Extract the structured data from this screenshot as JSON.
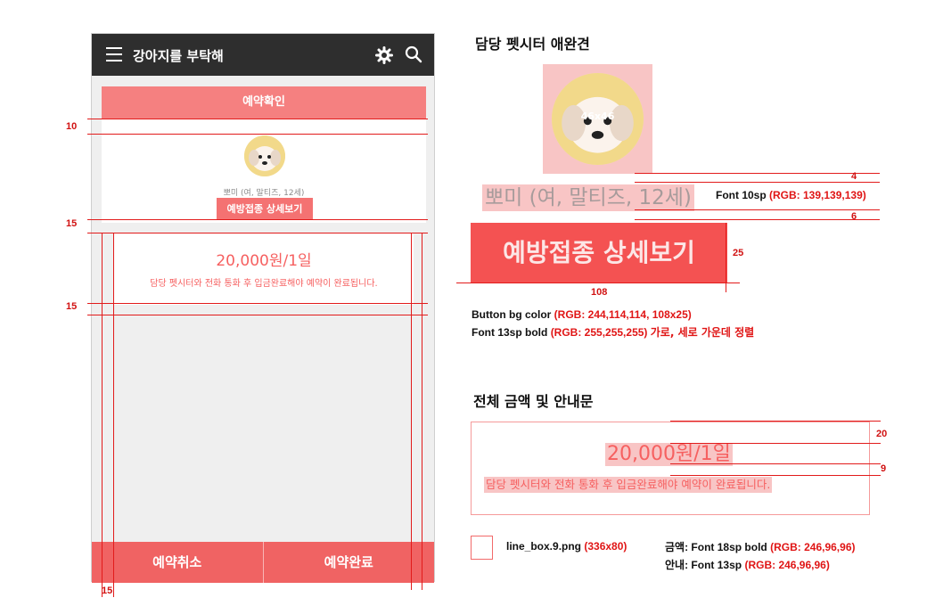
{
  "app": {
    "title": "강아지를 부탁해",
    "icons": [
      "hamburger-menu-icon",
      "gear-icon",
      "search-icon"
    ],
    "confirm_bar": "예약확인",
    "pet_info": "뽀미 (여, 말티즈, 12세)",
    "vaccination_button": "예방접종 상세보기",
    "price": "20,000원/1일",
    "notice": "담당 펫시터와 전화 통화 후 입금완료해야 예약이 완료됩니다.",
    "cancel_button": "예약취소",
    "complete_button": "예약완료"
  },
  "redlines": {
    "gap_10": "10",
    "gap_15_top": "15",
    "gap_15_mid": "15",
    "gap_15_side": "15"
  },
  "spec": {
    "sitter_heading": "담당 펫시터 애완견",
    "avatar_size": "46x46",
    "gap_4": "4",
    "pet_info_large": "뽀미 (여, 말티즈, 12세)",
    "pet_font_spec": "Font 10sp",
    "pet_font_rgb": "(RGB: 139,139,139)",
    "gap_6": "6",
    "button_large": "예방접종 상세보기",
    "button_height": "25",
    "button_width": "108",
    "button_bg_label": "Button bg color",
    "button_bg_rgb": "(RGB: 244,114,114, 108x25)",
    "button_font_label": "Font 13sp bold",
    "button_font_rgb": "(RGB: 255,255,255)",
    "button_align": "가로, 세로 가운데 정렬",
    "total_heading": "전체 금액 및 안내문",
    "gap_20": "20",
    "price_large": "20,000원/1일",
    "gap_9": "9",
    "notice_large": "담당 펫시터와 전화 통화 후 입금완료해야 예약이 완료됩니다.",
    "ninepatch_name": "line_box.9.png",
    "ninepatch_size": "(336x80)",
    "price_font_label_kr": "금액",
    "price_font_label": ": Font 18sp bold",
    "price_font_rgb": "(RGB: 246,96,96)",
    "notice_font_label_kr": "안내",
    "notice_font_label": ": Font 13sp",
    "notice_font_rgb": "(RGB:  246,96,96)"
  },
  "colors": {
    "appbar": "#2e2e2e",
    "confirm_bar": "#f58080",
    "vaccination_button": "#f47272",
    "price_text": "#f66060",
    "bottom_bar": "#f06363",
    "redline": "#e21b1b"
  }
}
